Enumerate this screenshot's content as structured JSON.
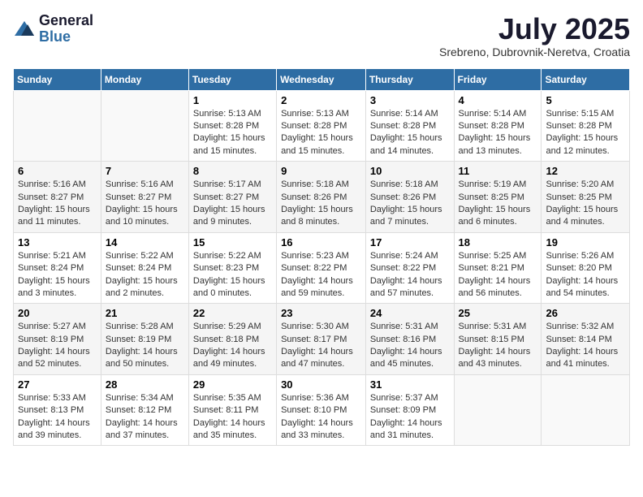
{
  "logo": {
    "general": "General",
    "blue": "Blue"
  },
  "title": "July 2025",
  "location": "Srebreno, Dubrovnik-Neretva, Croatia",
  "days_of_week": [
    "Sunday",
    "Monday",
    "Tuesday",
    "Wednesday",
    "Thursday",
    "Friday",
    "Saturday"
  ],
  "weeks": [
    [
      {
        "day": "",
        "info": ""
      },
      {
        "day": "",
        "info": ""
      },
      {
        "day": "1",
        "info": "Sunrise: 5:13 AM\nSunset: 8:28 PM\nDaylight: 15 hours and 15 minutes."
      },
      {
        "day": "2",
        "info": "Sunrise: 5:13 AM\nSunset: 8:28 PM\nDaylight: 15 hours and 15 minutes."
      },
      {
        "day": "3",
        "info": "Sunrise: 5:14 AM\nSunset: 8:28 PM\nDaylight: 15 hours and 14 minutes."
      },
      {
        "day": "4",
        "info": "Sunrise: 5:14 AM\nSunset: 8:28 PM\nDaylight: 15 hours and 13 minutes."
      },
      {
        "day": "5",
        "info": "Sunrise: 5:15 AM\nSunset: 8:28 PM\nDaylight: 15 hours and 12 minutes."
      }
    ],
    [
      {
        "day": "6",
        "info": "Sunrise: 5:16 AM\nSunset: 8:27 PM\nDaylight: 15 hours and 11 minutes."
      },
      {
        "day": "7",
        "info": "Sunrise: 5:16 AM\nSunset: 8:27 PM\nDaylight: 15 hours and 10 minutes."
      },
      {
        "day": "8",
        "info": "Sunrise: 5:17 AM\nSunset: 8:27 PM\nDaylight: 15 hours and 9 minutes."
      },
      {
        "day": "9",
        "info": "Sunrise: 5:18 AM\nSunset: 8:26 PM\nDaylight: 15 hours and 8 minutes."
      },
      {
        "day": "10",
        "info": "Sunrise: 5:18 AM\nSunset: 8:26 PM\nDaylight: 15 hours and 7 minutes."
      },
      {
        "day": "11",
        "info": "Sunrise: 5:19 AM\nSunset: 8:25 PM\nDaylight: 15 hours and 6 minutes."
      },
      {
        "day": "12",
        "info": "Sunrise: 5:20 AM\nSunset: 8:25 PM\nDaylight: 15 hours and 4 minutes."
      }
    ],
    [
      {
        "day": "13",
        "info": "Sunrise: 5:21 AM\nSunset: 8:24 PM\nDaylight: 15 hours and 3 minutes."
      },
      {
        "day": "14",
        "info": "Sunrise: 5:22 AM\nSunset: 8:24 PM\nDaylight: 15 hours and 2 minutes."
      },
      {
        "day": "15",
        "info": "Sunrise: 5:22 AM\nSunset: 8:23 PM\nDaylight: 15 hours and 0 minutes."
      },
      {
        "day": "16",
        "info": "Sunrise: 5:23 AM\nSunset: 8:22 PM\nDaylight: 14 hours and 59 minutes."
      },
      {
        "day": "17",
        "info": "Sunrise: 5:24 AM\nSunset: 8:22 PM\nDaylight: 14 hours and 57 minutes."
      },
      {
        "day": "18",
        "info": "Sunrise: 5:25 AM\nSunset: 8:21 PM\nDaylight: 14 hours and 56 minutes."
      },
      {
        "day": "19",
        "info": "Sunrise: 5:26 AM\nSunset: 8:20 PM\nDaylight: 14 hours and 54 minutes."
      }
    ],
    [
      {
        "day": "20",
        "info": "Sunrise: 5:27 AM\nSunset: 8:19 PM\nDaylight: 14 hours and 52 minutes."
      },
      {
        "day": "21",
        "info": "Sunrise: 5:28 AM\nSunset: 8:19 PM\nDaylight: 14 hours and 50 minutes."
      },
      {
        "day": "22",
        "info": "Sunrise: 5:29 AM\nSunset: 8:18 PM\nDaylight: 14 hours and 49 minutes."
      },
      {
        "day": "23",
        "info": "Sunrise: 5:30 AM\nSunset: 8:17 PM\nDaylight: 14 hours and 47 minutes."
      },
      {
        "day": "24",
        "info": "Sunrise: 5:31 AM\nSunset: 8:16 PM\nDaylight: 14 hours and 45 minutes."
      },
      {
        "day": "25",
        "info": "Sunrise: 5:31 AM\nSunset: 8:15 PM\nDaylight: 14 hours and 43 minutes."
      },
      {
        "day": "26",
        "info": "Sunrise: 5:32 AM\nSunset: 8:14 PM\nDaylight: 14 hours and 41 minutes."
      }
    ],
    [
      {
        "day": "27",
        "info": "Sunrise: 5:33 AM\nSunset: 8:13 PM\nDaylight: 14 hours and 39 minutes."
      },
      {
        "day": "28",
        "info": "Sunrise: 5:34 AM\nSunset: 8:12 PM\nDaylight: 14 hours and 37 minutes."
      },
      {
        "day": "29",
        "info": "Sunrise: 5:35 AM\nSunset: 8:11 PM\nDaylight: 14 hours and 35 minutes."
      },
      {
        "day": "30",
        "info": "Sunrise: 5:36 AM\nSunset: 8:10 PM\nDaylight: 14 hours and 33 minutes."
      },
      {
        "day": "31",
        "info": "Sunrise: 5:37 AM\nSunset: 8:09 PM\nDaylight: 14 hours and 31 minutes."
      },
      {
        "day": "",
        "info": ""
      },
      {
        "day": "",
        "info": ""
      }
    ]
  ]
}
